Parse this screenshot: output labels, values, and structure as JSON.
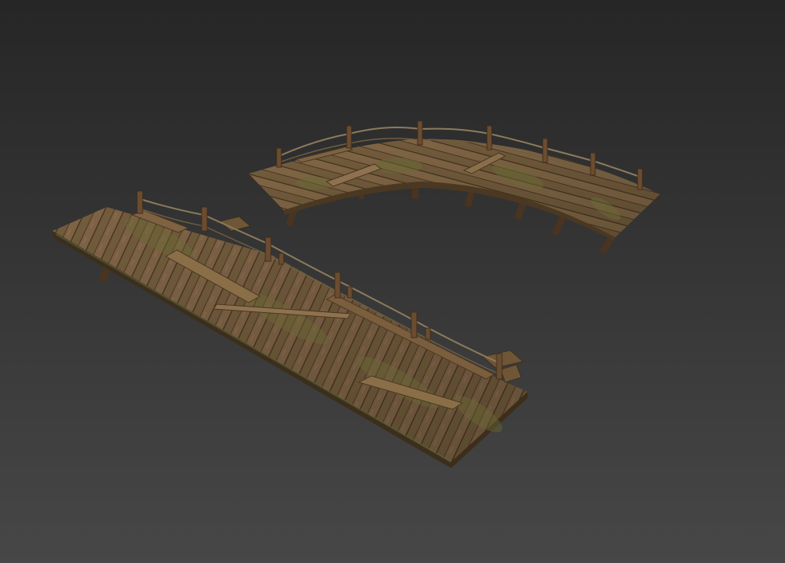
{
  "scene": {
    "background_top": "#262626",
    "background_bottom": "#474747",
    "wood_light": "#8a6e48",
    "wood_mid": "#6e5636",
    "wood_dark": "#4a3822",
    "moss": "#6b6a36",
    "post_color": "#6b4c30",
    "rope_color": "#8c7a5c"
  },
  "objects": [
    {
      "name": "curved-bridge",
      "kind": "curved wooden walkway with rope railing"
    },
    {
      "name": "straight-bridge",
      "kind": "straight wooden walkway with rope railing"
    }
  ]
}
